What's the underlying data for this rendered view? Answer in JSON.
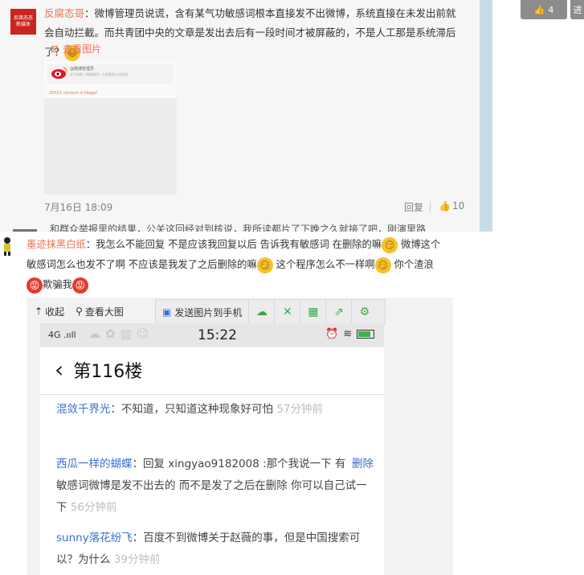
{
  "top_right": {
    "like_count": "4",
    "cut_label": "进"
  },
  "comment1": {
    "avatar_text": "反腐态态\n新媒体",
    "username": "反腐态哥",
    "text": "：微博管理员说谎，含有某气功敏感词根本直接发不出微博，系统直接在未发出前就会自动拦截。而共青团中央的文章是发出去后有一段时间才被屏蔽的，不是人工那是系统滞后了？",
    "emoji": "laugh-emoji",
    "view_image_label": "查看图片",
    "thumb": {
      "admin_name": "@微博管理员",
      "admin_sub": "关于有微《谣微博开》七新闻发过对应视",
      "illegal_msg": "20021 content is illegal!"
    },
    "date": "7月16日 18:09",
    "reply_label": "回复",
    "like_count": "10",
    "next_truncated": "和群众举报里的结果，公关这回经对到核说，我所读都片了下晚之久就接了吧，刚演里路"
  },
  "comment2": {
    "username": "墨迹抹黑白纸",
    "seg1": "：我怎么不能回复 不是应该我回复以后 告诉我有敏感词 在删除的嘛",
    "seg2": " 微博这个敏感词怎么也发不了啊 不应该是我发了之后删除的嘛",
    "seg3": " 这个程序怎么不一样啊",
    "seg4": " 你个渣浪",
    "seg5": "欺骗我"
  },
  "toolbar": {
    "collapse_label": "收起",
    "view_large_label": "查看大图",
    "send_label": "发送图片到手机"
  },
  "phone": {
    "network": "4G .ııll",
    "time": "15:22",
    "title": "第116楼",
    "posts": [
      {
        "name": "混敛千界光",
        "text": "：不知道，只知道这种现象好可怕",
        "time": "57分钟前"
      },
      {
        "name": "西瓜一样的蝴蝶",
        "text": "：回复 xingyao9182008 :那个我说一下 有敏感词微博是发不出去的 而不是发了之后在删除 你可以自己试一下",
        "time": "56分钟前",
        "delete": "删除"
      },
      {
        "name": "sunny落花纷飞",
        "text": "：百度不到微博关于赵薇的事，但是中国搜索可以？为什么",
        "time": "39分钟前"
      }
    ]
  },
  "colors": {
    "username": "#eb7350",
    "hw_name": "#3a6fcf",
    "toolbar_icon": "#3aa845"
  }
}
